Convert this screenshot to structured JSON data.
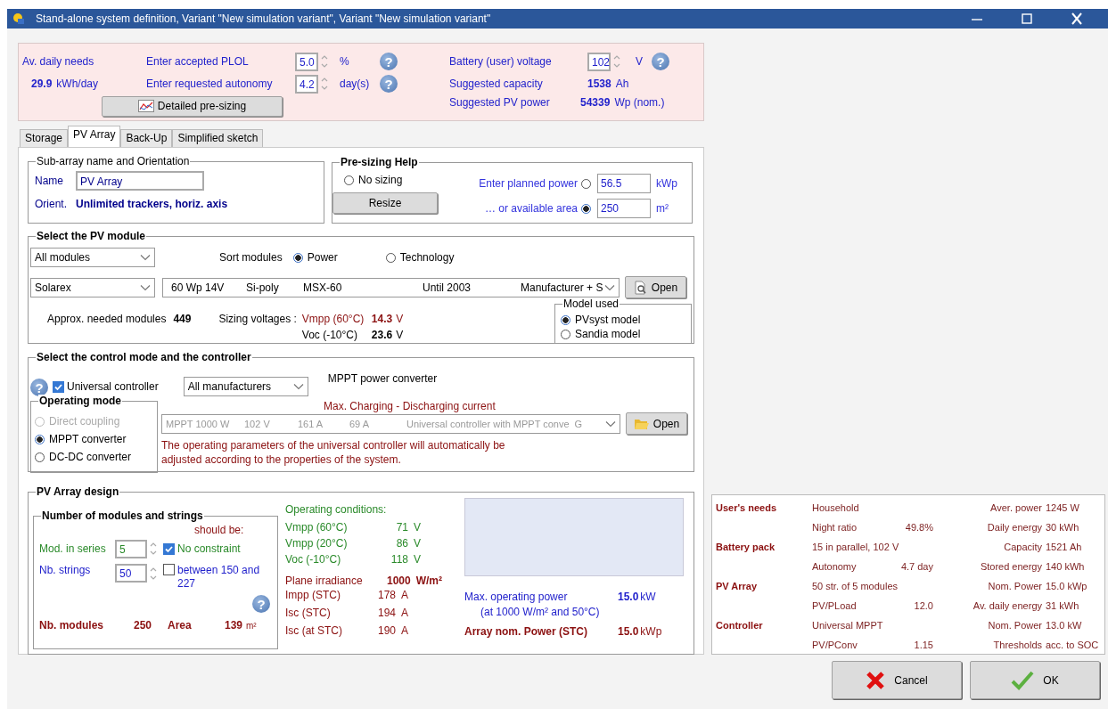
{
  "window": {
    "title": "Stand-alone system definition, Variant  \"New simulation variant\", Variant  \"New simulation variant\""
  },
  "presizing": {
    "needs": {
      "label": "Av. daily needs",
      "value": "29.9",
      "unit": "kWh/day"
    },
    "plol": {
      "label": "Enter accepted PLOL",
      "value": "5.0",
      "unit": "%",
      "help": "?"
    },
    "autonomy": {
      "label": "Enter requested autonomy",
      "value": "4.2",
      "unit": "day(s)",
      "help": "?"
    },
    "detailed_button": "Detailed pre-sizing",
    "battery_voltage": {
      "label": "Battery (user) voltage",
      "value": "102",
      "unit": "V",
      "help": "?"
    },
    "suggested": [
      {
        "label": "Suggested capacity",
        "value": "1538",
        "unit": "Ah"
      },
      {
        "label": "Suggested PV power",
        "value": "54339",
        "unit": "Wp (nom.)"
      }
    ]
  },
  "tabs": [
    {
      "label": "Storage",
      "selected": false
    },
    {
      "label": "PV Array",
      "selected": true
    },
    {
      "label": "Back-Up",
      "selected": false
    },
    {
      "label": "Simplified sketch",
      "selected": false
    }
  ],
  "subarray": {
    "title": "Sub-array name and Orientation",
    "name_label": "Name",
    "name_value": "PV Array",
    "orient_label": "Orient.",
    "orient_value": "Unlimited trackers, horiz. axis"
  },
  "presizing_help": {
    "title": "Pre-sizing Help",
    "no_sizing": {
      "label": "No sizing",
      "selected": false
    },
    "resize_button": "Resize",
    "options": [
      {
        "label": "Enter planned power",
        "selected": false,
        "value": "56.5",
        "unit": "kWp"
      },
      {
        "label": "…  or available area",
        "selected": true,
        "value": "250",
        "unit": "m²"
      }
    ]
  },
  "pv_module": {
    "title": "Select the PV module",
    "filter": "All modules",
    "sort_label": "Sort modules",
    "sort_options": [
      {
        "label": "Power",
        "selected": true
      },
      {
        "label": "Technology",
        "selected": false
      }
    ],
    "manufacturer": "Solarex",
    "module": [
      "60 Wp 14V",
      "Si-poly",
      "MSX-60",
      "Until 2003",
      "Manufacturer + S"
    ],
    "open_button": "Open",
    "needed_label": "Approx. needed modules",
    "needed_value": "449",
    "sizing_label": "Sizing voltages :",
    "voltages": [
      {
        "label": "Vmpp (60°C)",
        "value": "14.3",
        "unit": "V",
        "color": "#8b1010"
      },
      {
        "label": "Voc (-10°C)",
        "value": "23.6",
        "unit": "V",
        "color": "#000000"
      }
    ],
    "model_used": {
      "title": "Model used",
      "options": [
        {
          "label": "PVsyst model",
          "selected": true
        },
        {
          "label": "Sandia model",
          "selected": false
        }
      ]
    }
  },
  "controller": {
    "title": "Select the control mode and the controller",
    "help": "?",
    "universal": {
      "label": "Universal controller",
      "checked": true
    },
    "manufacturer": "All manufacturers",
    "heading": "MPPT power converter",
    "current_label": "Max. Charging - Discharging current",
    "operating_mode": {
      "title": "Operating mode",
      "options": [
        {
          "label": "Direct coupling",
          "selected": false,
          "disabled": true
        },
        {
          "label": "MPPT converter",
          "selected": true,
          "disabled": false
        },
        {
          "label": "DC-DC converter",
          "selected": false,
          "disabled": false
        }
      ]
    },
    "device": {
      "fields": [
        "MPPT 1000 W",
        "102 V",
        "161 A",
        "69 A",
        "Universal controller with MPPT conve",
        "G"
      ],
      "disabled": true
    },
    "open_button": "Open",
    "note": "The operating parameters of the universal controller will automatically be adjusted according to the properties of the system."
  },
  "design": {
    "title": "PV Array design",
    "strings": {
      "title": "Number of modules and strings",
      "should_be": "should be:",
      "help": "?",
      "series": {
        "label": "Mod. in series",
        "value": "5"
      },
      "count": {
        "label": "Nb. strings",
        "value": "50"
      },
      "constraints": [
        {
          "label": "No constraint",
          "checked": true
        },
        {
          "label": "between 150 and 227",
          "checked": false
        }
      ],
      "nb_modules": {
        "label": "Nb. modules",
        "value": "250"
      },
      "area": {
        "label": "Area",
        "value": "139",
        "unit": "m²"
      }
    },
    "operating": {
      "title": "Operating conditions:",
      "rows": [
        {
          "label": "Vmpp (60°C)",
          "value": "71",
          "unit": "V"
        },
        {
          "label": "Vmpp (20°C)",
          "value": "86",
          "unit": "V"
        },
        {
          "label": "Voc (-10°C)",
          "value": "118",
          "unit": "V"
        }
      ]
    },
    "irradiance": {
      "label": "Plane irradiance",
      "value": "1000",
      "unit": "W/m²"
    },
    "currents": [
      {
        "label": "Impp (STC)",
        "value": "178",
        "unit": "A"
      },
      {
        "label": "Isc (STC)",
        "value": "194",
        "unit": "A"
      },
      {
        "label": "Isc (at STC)",
        "value": "190",
        "unit": "A"
      }
    ],
    "max_power": {
      "label": "Max. operating power",
      "value": "15.0",
      "unit": "kW",
      "note": "(at 1000 W/m²  and 50°C)"
    },
    "nom_power": {
      "label": "Array nom. Power (STC)",
      "value": "15.0",
      "unit": "kWp"
    }
  },
  "summary": [
    {
      "section": "User's needs",
      "item": "Household",
      "name": "Aver. power",
      "value": "1245 W"
    },
    {
      "item": "Night ratio",
      "item_value": "49.8%",
      "name": "Daily energy",
      "value": "30 kWh"
    },
    {
      "section": "Battery pack",
      "item": "15 in parallel, 102 V",
      "name": "Capacity",
      "value": "1521 Ah"
    },
    {
      "item": "Autonomy",
      "item_value": "4.7 day",
      "name": "Stored energy",
      "value": "140 kWh"
    },
    {
      "section": "PV Array",
      "item": "50 str. of 5 modules",
      "name": "Nom. Power",
      "value": "15.0 kWp"
    },
    {
      "item": "PV/PLoad",
      "item_value": "12.0",
      "name": "Av. daily energy",
      "value": "31 kWh"
    },
    {
      "section": "Controller",
      "item": "Universal MPPT",
      "name": "Nom. Power",
      "value": "13.0 kW"
    },
    {
      "item": "PV/PConv",
      "item_value": "1.15",
      "name": "Thresholds",
      "value": "acc. to SOC"
    }
  ],
  "buttons": [
    {
      "label": "Cancel",
      "kind": "cancel"
    },
    {
      "label": "OK",
      "kind": "ok"
    }
  ]
}
